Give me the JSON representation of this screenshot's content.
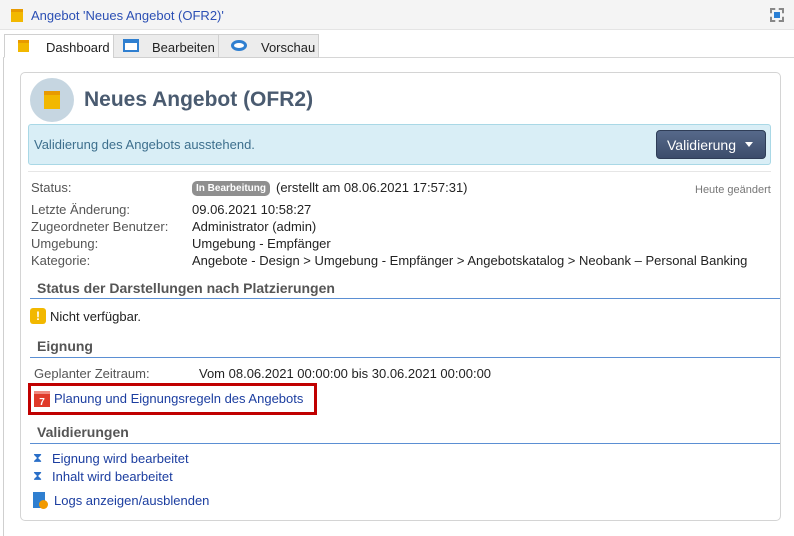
{
  "window": {
    "title": "Angebot 'Neues Angebot (OFR2)'",
    "icon": "gift-icon",
    "action_icon": "maximize-icon"
  },
  "tabs": [
    {
      "label": "Dashboard",
      "icon": "gift-icon",
      "active": true
    },
    {
      "label": "Bearbeiten",
      "icon": "window-icon"
    },
    {
      "label": "Vorschau",
      "icon": "eye-icon"
    }
  ],
  "header": {
    "title": "Neues Angebot (OFR2)"
  },
  "alert": {
    "text": "Validierung des Angebots ausstehend.",
    "button": "Validierung"
  },
  "details": {
    "status_label": "Status:",
    "status_badge": "In Bearbeitung",
    "status_created": "(erstellt am 08.06.2021 17:57:31)",
    "changed_note": "Heute geändert",
    "last_change_label": "Letzte Änderung:",
    "last_change": "09.06.2021 10:58:27",
    "user_label": "Zugeordneter Benutzer:",
    "user": "Administrator (admin)",
    "env_label": "Umgebung:",
    "env": "Umgebung - Empfänger",
    "cat_label": "Kategorie:",
    "cat": "Angebote - Design > Umgebung - Empfänger > Angebotskatalog > Neobank – Personal Banking"
  },
  "placements": {
    "heading": "Status der Darstellungen nach Platzierungen",
    "text": "Nicht verfügbar."
  },
  "eligibility": {
    "heading": "Eignung",
    "period_label": "Geplanter Zeitraum:",
    "period": "Vom 08.06.2021 00:00:00 bis 30.06.2021 00:00:00",
    "link": "Planung und Eignungsregeln des Angebots",
    "highlight_color": "#c00000"
  },
  "validations": {
    "heading": "Validierungen",
    "items": [
      "Eignung wird bearbeitet",
      "Inhalt wird bearbeitet"
    ],
    "logs": "Logs anzeigen/ausblenden"
  }
}
